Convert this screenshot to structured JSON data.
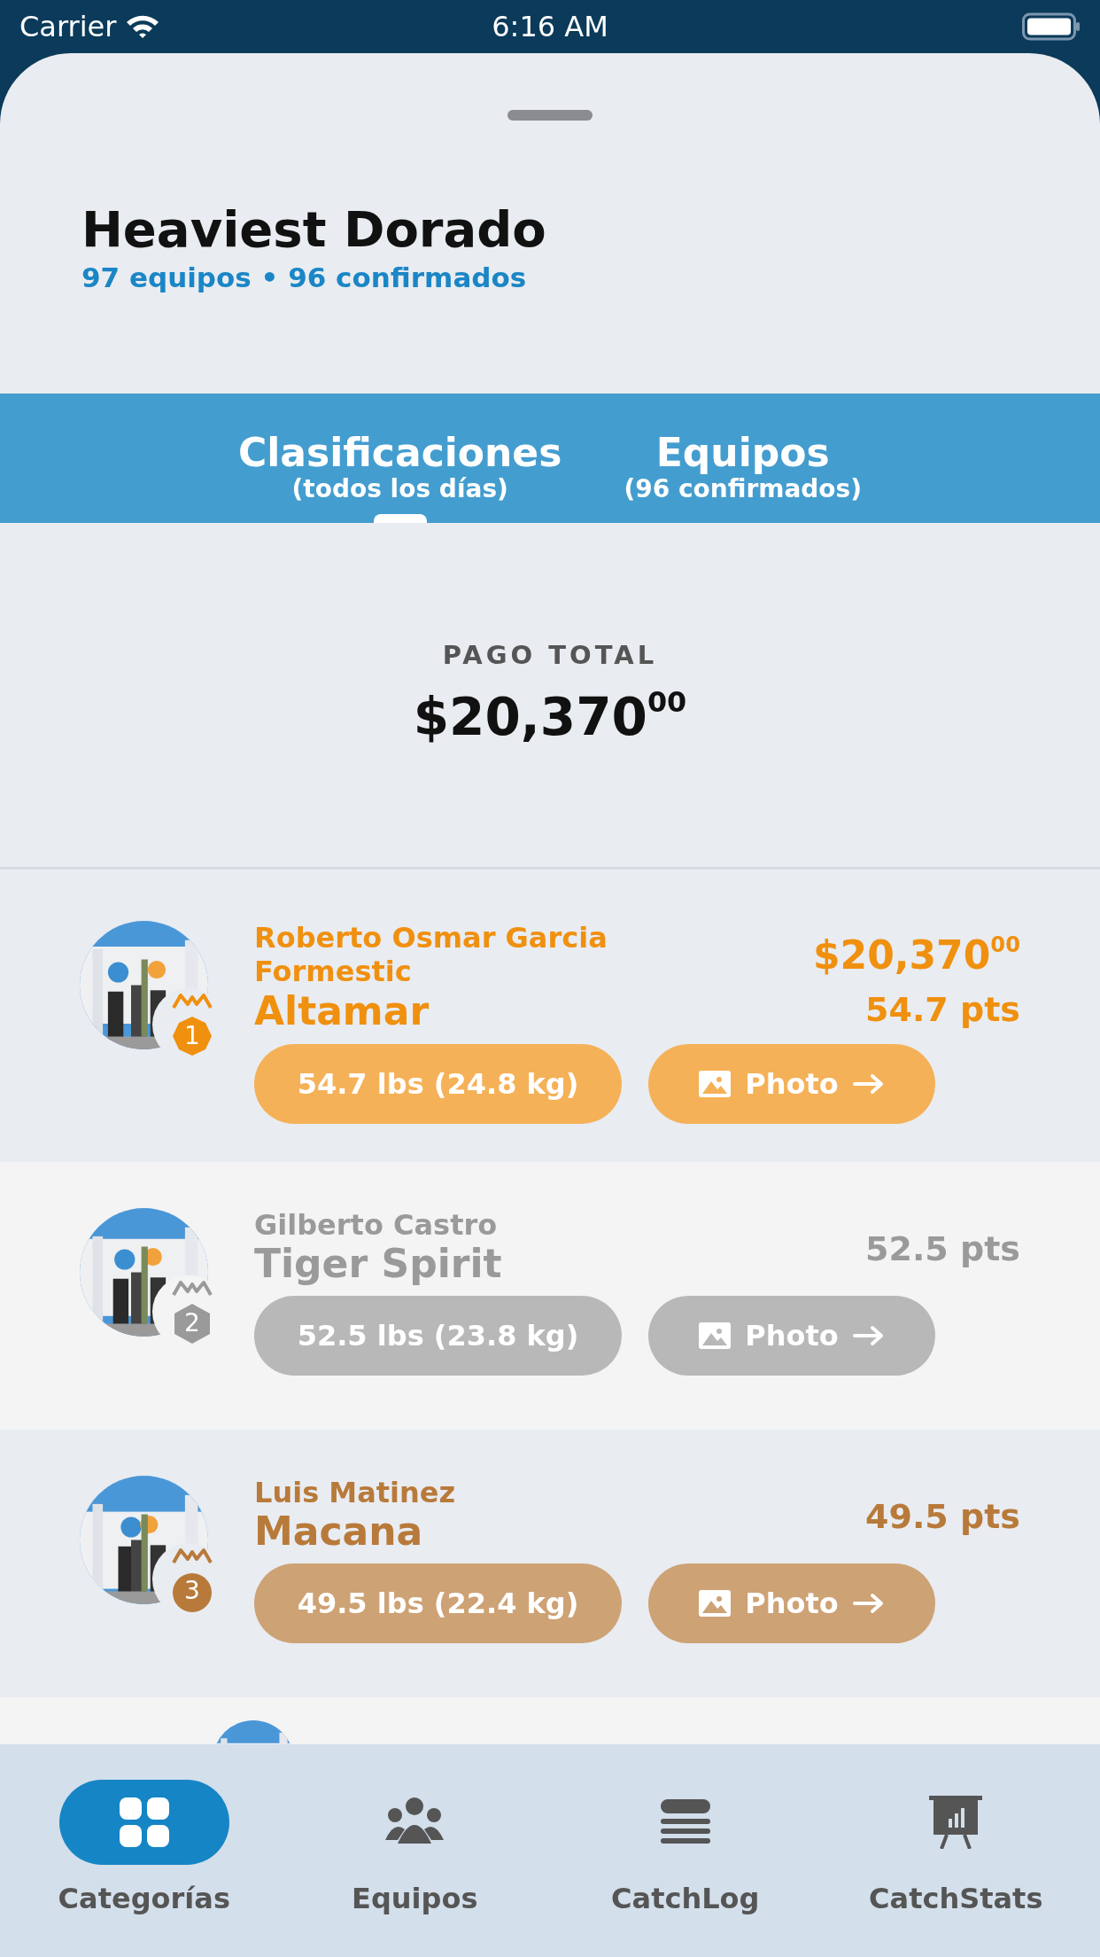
{
  "status_bar": {
    "carrier": "Carrier",
    "time": "6:16 AM"
  },
  "header": {
    "title": "Heaviest Dorado",
    "subtitle": "97 equipos • 96 confirmados"
  },
  "tabs": [
    {
      "label": "Clasificaciones",
      "sublabel": "(todos los días)",
      "selected": true
    },
    {
      "label": "Equipos",
      "sublabel": "(96 confirmados)",
      "selected": false
    }
  ],
  "payout": {
    "label": "PAGO TOTAL",
    "amount": "$20,370$^{00}$"
  },
  "rows": [
    {
      "angler": "Roberto Osmar Garcia Formestic",
      "team": "Altamar",
      "prize": "$20,370$^{00}$",
      "points": "54.7 pts",
      "rank": "1",
      "color": "#f0900f",
      "weight": "54.7 lbs (24.8 kg)",
      "photo": "Photo"
    },
    {
      "angler": "Gilberto Castro",
      "team": "Tiger Spirit",
      "points": "52.5 pts",
      "rank": "2",
      "color": "#9a9a9a",
      "weight": "52.5 lbs (23.8 kg)",
      "photo": "Photo"
    },
    {
      "angler": "Luis Matinez",
      "team": "Macana",
      "points": "49.5 pts",
      "rank": "3",
      "color": "#b87a3a",
      "weight": "49.5 lbs (22.4 kg)",
      "photo": "Photo"
    },
    {
      "kind": "partial"
    }
  ],
  "bottom_nav": [
    {
      "label": "Categorías",
      "selected": true
    },
    {
      "label": "Equipos",
      "selected": false
    },
    {
      "label": "CatchLog",
      "selected": false
    },
    {
      "label": "CatchStats",
      "selected": false
    }
  ]
}
